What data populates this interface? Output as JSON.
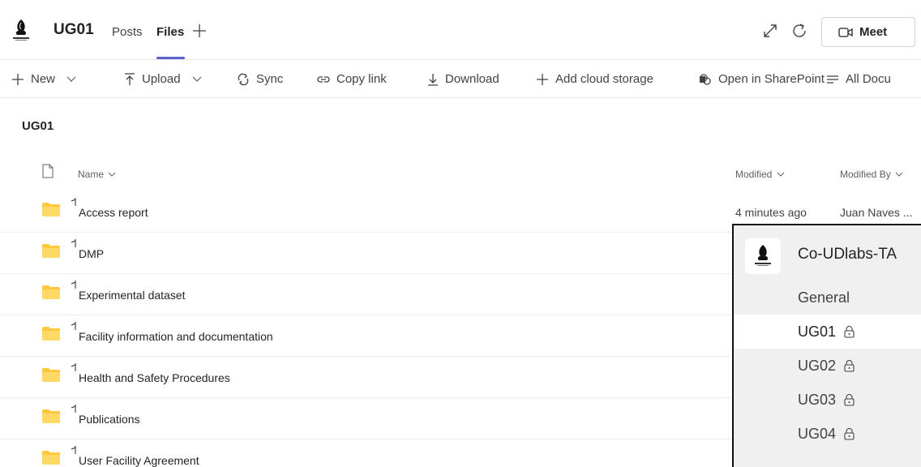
{
  "header": {
    "team_name": "UG01",
    "tabs": [
      {
        "label": "Posts",
        "active": false
      },
      {
        "label": "Files",
        "active": true
      }
    ],
    "add_tab_icon": "plus-icon",
    "meet_label": "Meet"
  },
  "toolbar": {
    "items": [
      {
        "icon": "plus-icon",
        "label": "New",
        "dropdown": true
      },
      {
        "icon": "upload-icon",
        "label": "Upload",
        "dropdown": true
      },
      {
        "icon": "sync-icon",
        "label": "Sync"
      },
      {
        "icon": "link-icon",
        "label": "Copy link"
      },
      {
        "icon": "download-icon",
        "label": "Download"
      },
      {
        "icon": "plus-icon",
        "label": "Add cloud storage"
      },
      {
        "icon": "sharepoint-icon",
        "label": "Open in SharePoint"
      },
      {
        "icon": "view-icon",
        "label": "All Docu"
      }
    ]
  },
  "library": {
    "title": "UG01",
    "columns": {
      "name": "Name",
      "modified": "Modified",
      "modified_by": "Modified By"
    },
    "rows": [
      {
        "name": "Access report",
        "modified": "4 minutes ago",
        "modified_by": "Juan Naves ..."
      },
      {
        "name": "DMP",
        "modified": "",
        "modified_by": ""
      },
      {
        "name": "Experimental dataset",
        "modified": "",
        "modified_by": ""
      },
      {
        "name": "Facility information and documentation",
        "modified": "",
        "modified_by": ""
      },
      {
        "name": "Health and Safety Procedures",
        "modified": "",
        "modified_by": ""
      },
      {
        "name": "Publications",
        "modified": "",
        "modified_by": ""
      },
      {
        "name": "User Facility Agreement",
        "modified": "",
        "modified_by": ""
      }
    ]
  },
  "channel_popout": {
    "team": "Co-UDlabs-TA",
    "channels": [
      {
        "label": "General",
        "private": false,
        "active": false
      },
      {
        "label": "UG01",
        "private": true,
        "active": true
      },
      {
        "label": "UG02",
        "private": true,
        "active": false
      },
      {
        "label": "UG03",
        "private": true,
        "active": false
      },
      {
        "label": "UG04",
        "private": true,
        "active": false
      }
    ]
  },
  "colors": {
    "accent": "#5b5fc7",
    "folder": "#ffc83d"
  }
}
